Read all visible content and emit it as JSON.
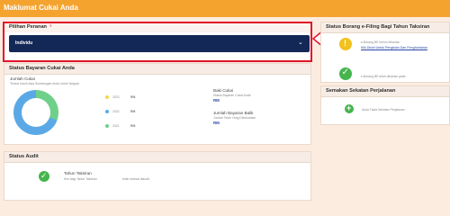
{
  "header": {
    "title": "Maklumat Cukai Anda"
  },
  "pilihan": {
    "title": "Pilihan Peranan",
    "help": "?",
    "selected": "Individu"
  },
  "status_bayaran": {
    "title": "Status Bayaran Cukai Anda",
    "jumlah_cukai": "Jumlah Cukai",
    "subtitle": "Terima Kasih Atas Sumbangan Anda Untuk Negara",
    "years": [
      {
        "year": "2023",
        "prefix": "RM",
        "color": "#f2d64b"
      },
      {
        "year": "2022",
        "prefix": "RM",
        "color": "#5aa9e6"
      },
      {
        "year": "2021",
        "prefix": "RM",
        "color": "#6fd08a"
      }
    ],
    "baki": {
      "title": "Baki Cukai",
      "desc": "Status Bayaran Cukai Anda",
      "prefix": "RM"
    },
    "jumlah_balik": {
      "title": "Jumlah Bayaran Balik",
      "desc": "Jumlah Telah Yang Dikeluarkan",
      "prefix": "RM"
    }
  },
  "audit": {
    "title": "Status Audit",
    "tahun_label": "Tahun Taksiran",
    "desc": "Kes bagi Tahun Taksiran",
    "desc2": "telah selesai diaudit."
  },
  "borang": {
    "title": "Status Borang e-Filing Bagi Tahun Taksiran",
    "item1_line1": "e-Borang BE belum dihantar",
    "item1_link": "Klik Disini Untuk Pengisian Dan Penghantaran",
    "item2_line1": "e-Borang BE telah dihantar pada",
    "colors": {
      "warning": "#f2c11d",
      "success": "#46b54d"
    }
  },
  "semakan": {
    "title": "Semakan Sekatan Perjalanan",
    "status": "Anda Tiada Sekatan Perjalanan"
  }
}
